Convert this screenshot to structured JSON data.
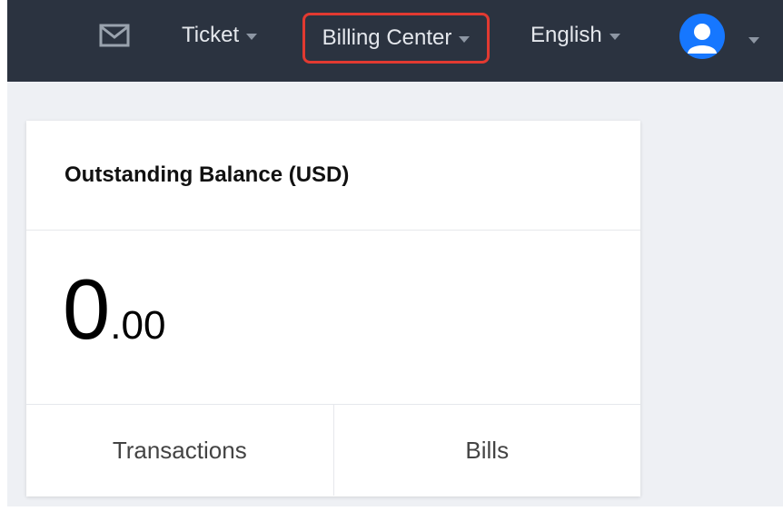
{
  "topbar": {
    "mail_icon": "envelope-icon",
    "ticket_label": "Ticket",
    "billing_label": "Billing Center",
    "language_label": "English",
    "avatar_icon": "user-avatar-icon",
    "dropdown_icon": "caret-down-icon"
  },
  "balance_card": {
    "title": "Outstanding Balance (USD)",
    "amount_integer": "0",
    "amount_decimal": ".00",
    "transactions_label": "Transactions",
    "bills_label": "Bills"
  },
  "colors": {
    "topbar_bg": "#2b3340",
    "highlight_border": "#e23a31",
    "avatar_bg": "#1677ff",
    "page_bg": "#eef0f4"
  }
}
